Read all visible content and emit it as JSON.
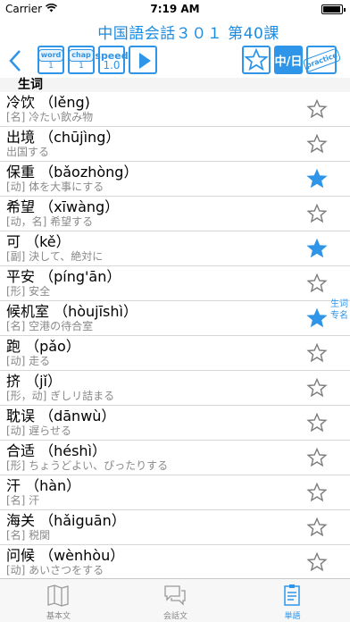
{
  "status_bar": {
    "carrier": "Carrier",
    "time": "7:19 AM",
    "battery_level": 0.95
  },
  "header": {
    "title": "中国語会話３０１ 第40課"
  },
  "toolbar": {
    "word_label": "word",
    "word_num": "1",
    "chapter_label": "chap",
    "chapter_num": "1",
    "speed_label": "speed",
    "speed_value": "1.0",
    "lang_label": "中/日",
    "practice_label": "practice"
  },
  "section": {
    "title": "生词"
  },
  "side_label": {
    "line1": "生词",
    "line2": "专名"
  },
  "words": [
    {
      "word": "冷饮 （lěng)",
      "meaning": "[名] 冷たい飲み物",
      "starred": false
    },
    {
      "word": "出境 （chūjìng）",
      "meaning": "出国する",
      "starred": false
    },
    {
      "word": "保重 （bǎozhòng）",
      "meaning": "[动] 体を大事にする",
      "starred": true
    },
    {
      "word": "希望 （xīwàng）",
      "meaning": "[动，名] 希望する",
      "starred": false
    },
    {
      "word": "可 （kě）",
      "meaning": "[副] 決して、絶対に",
      "starred": true
    },
    {
      "word": "平安 （píng'ān）",
      "meaning": "[形] 安全",
      "starred": false
    },
    {
      "word": "候机室 （hòujīshì）",
      "meaning": "[名] 空港の待合室",
      "starred": true
    },
    {
      "word": "跑 （pǎo）",
      "meaning": "[动] 走る",
      "starred": false
    },
    {
      "word": "挤 （jǐ）",
      "meaning": "[形，动] ぎしリ詰まる",
      "starred": false
    },
    {
      "word": "耽误 （dānwù）",
      "meaning": "[动] 遅らせる",
      "starred": false
    },
    {
      "word": "合适 （héshì）",
      "meaning": "[形] ちょうどよい、ぴったりする",
      "starred": false
    },
    {
      "word": "汗 （hàn）",
      "meaning": "[名] 汗",
      "starred": false
    },
    {
      "word": "海关 （hǎiguān）",
      "meaning": "[名] 税関",
      "starred": false
    },
    {
      "word": "问候 （wènhòu）",
      "meaning": "[动] あいさつをする",
      "starred": false
    }
  ],
  "tabs": [
    {
      "label": "基本文",
      "icon": "book-icon",
      "active": false
    },
    {
      "label": "会話文",
      "icon": "chat-bubbles-icon",
      "active": false
    },
    {
      "label": "単語",
      "icon": "vocabulary-icon",
      "active": true
    }
  ],
  "colors": {
    "accent": "#2e95e8",
    "title": "#1a8be0",
    "meaning_text": "#8a8a8a"
  }
}
